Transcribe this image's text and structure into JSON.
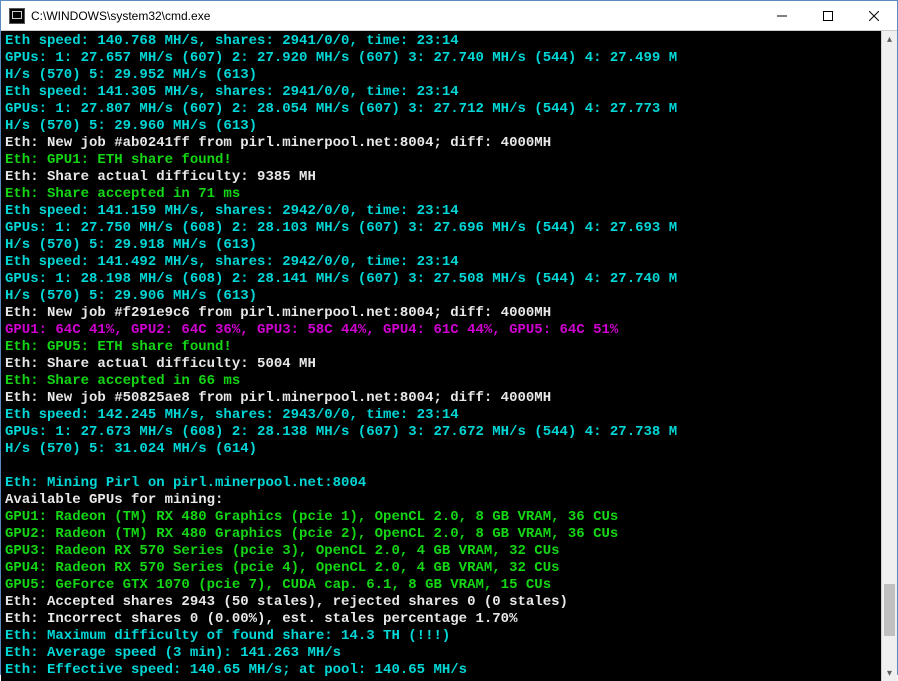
{
  "window": {
    "title": "C:\\WINDOWS\\system32\\cmd.exe"
  },
  "lines": [
    {
      "cls": "cyan",
      "text": "Eth speed: 140.768 MH/s, shares: 2941/0/0, time: 23:14"
    },
    {
      "cls": "cyan",
      "text": "GPUs: 1: 27.657 MH/s (607) 2: 27.920 MH/s (607) 3: 27.740 MH/s (544) 4: 27.499 M"
    },
    {
      "cls": "cyan",
      "text": "H/s (570) 5: 29.952 MH/s (613)"
    },
    {
      "cls": "cyan",
      "text": "Eth speed: 141.305 MH/s, shares: 2941/0/0, time: 23:14"
    },
    {
      "cls": "cyan",
      "text": "GPUs: 1: 27.807 MH/s (607) 2: 28.054 MH/s (607) 3: 27.712 MH/s (544) 4: 27.773 M"
    },
    {
      "cls": "cyan",
      "text": "H/s (570) 5: 29.960 MH/s (613)"
    },
    {
      "cls": "white",
      "text": "Eth: New job #ab0241ff from pirl.minerpool.net:8004; diff: 4000MH"
    },
    {
      "cls": "green",
      "text": "Eth: GPU1: ETH share found!"
    },
    {
      "cls": "white",
      "text": "Eth: Share actual difficulty: 9385 MH"
    },
    {
      "cls": "green",
      "text": "Eth: Share accepted in 71 ms"
    },
    {
      "cls": "cyan",
      "text": "Eth speed: 141.159 MH/s, shares: 2942/0/0, time: 23:14"
    },
    {
      "cls": "cyan",
      "text": "GPUs: 1: 27.750 MH/s (608) 2: 28.103 MH/s (607) 3: 27.696 MH/s (544) 4: 27.693 M"
    },
    {
      "cls": "cyan",
      "text": "H/s (570) 5: 29.918 MH/s (613)"
    },
    {
      "cls": "cyan",
      "text": "Eth speed: 141.492 MH/s, shares: 2942/0/0, time: 23:14"
    },
    {
      "cls": "cyan",
      "text": "GPUs: 1: 28.198 MH/s (608) 2: 28.141 MH/s (607) 3: 27.508 MH/s (544) 4: 27.740 M"
    },
    {
      "cls": "cyan",
      "text": "H/s (570) 5: 29.906 MH/s (613)"
    },
    {
      "cls": "white",
      "text": "Eth: New job #f291e9c6 from pirl.minerpool.net:8004; diff: 4000MH"
    },
    {
      "cls": "magenta",
      "text": "GPU1: 64C 41%, GPU2: 64C 36%, GPU3: 58C 44%, GPU4: 61C 44%, GPU5: 64C 51%"
    },
    {
      "cls": "green",
      "text": "Eth: GPU5: ETH share found!"
    },
    {
      "cls": "white",
      "text": "Eth: Share actual difficulty: 5004 MH"
    },
    {
      "cls": "green",
      "text": "Eth: Share accepted in 66 ms"
    },
    {
      "cls": "white",
      "text": "Eth: New job #50825ae8 from pirl.minerpool.net:8004; diff: 4000MH"
    },
    {
      "cls": "cyan",
      "text": "Eth speed: 142.245 MH/s, shares: 2943/0/0, time: 23:14"
    },
    {
      "cls": "cyan",
      "text": "GPUs: 1: 27.673 MH/s (608) 2: 28.138 MH/s (607) 3: 27.672 MH/s (544) 4: 27.738 M"
    },
    {
      "cls": "cyan",
      "text": "H/s (570) 5: 31.024 MH/s (614)"
    },
    {
      "cls": "blank",
      "text": ""
    },
    {
      "cls": "cyan",
      "text": "Eth: Mining Pirl on pirl.minerpool.net:8004"
    },
    {
      "cls": "white",
      "text": "Available GPUs for mining:"
    },
    {
      "cls": "green",
      "text": "GPU1: Radeon (TM) RX 480 Graphics (pcie 1), OpenCL 2.0, 8 GB VRAM, 36 CUs"
    },
    {
      "cls": "green",
      "text": "GPU2: Radeon (TM) RX 480 Graphics (pcie 2), OpenCL 2.0, 8 GB VRAM, 36 CUs"
    },
    {
      "cls": "green",
      "text": "GPU3: Radeon RX 570 Series (pcie 3), OpenCL 2.0, 4 GB VRAM, 32 CUs"
    },
    {
      "cls": "green",
      "text": "GPU4: Radeon RX 570 Series (pcie 4), OpenCL 2.0, 4 GB VRAM, 32 CUs"
    },
    {
      "cls": "green",
      "text": "GPU5: GeForce GTX 1070 (pcie 7), CUDA cap. 6.1, 8 GB VRAM, 15 CUs"
    },
    {
      "cls": "white",
      "text": "Eth: Accepted shares 2943 (50 stales), rejected shares 0 (0 stales)"
    },
    {
      "cls": "white",
      "text": "Eth: Incorrect shares 0 (0.00%), est. stales percentage 1.70%"
    },
    {
      "cls": "cyan",
      "text": "Eth: Maximum difficulty of found share: 14.3 TH (!!!)"
    },
    {
      "cls": "cyan",
      "text": "Eth: Average speed (3 min): 141.263 MH/s"
    },
    {
      "cls": "cyan",
      "text": "Eth: Effective speed: 140.65 MH/s; at pool: 140.65 MH/s"
    }
  ],
  "scrollbar": {
    "thumb_top_pct": 85,
    "thumb_height_pct": 8
  }
}
